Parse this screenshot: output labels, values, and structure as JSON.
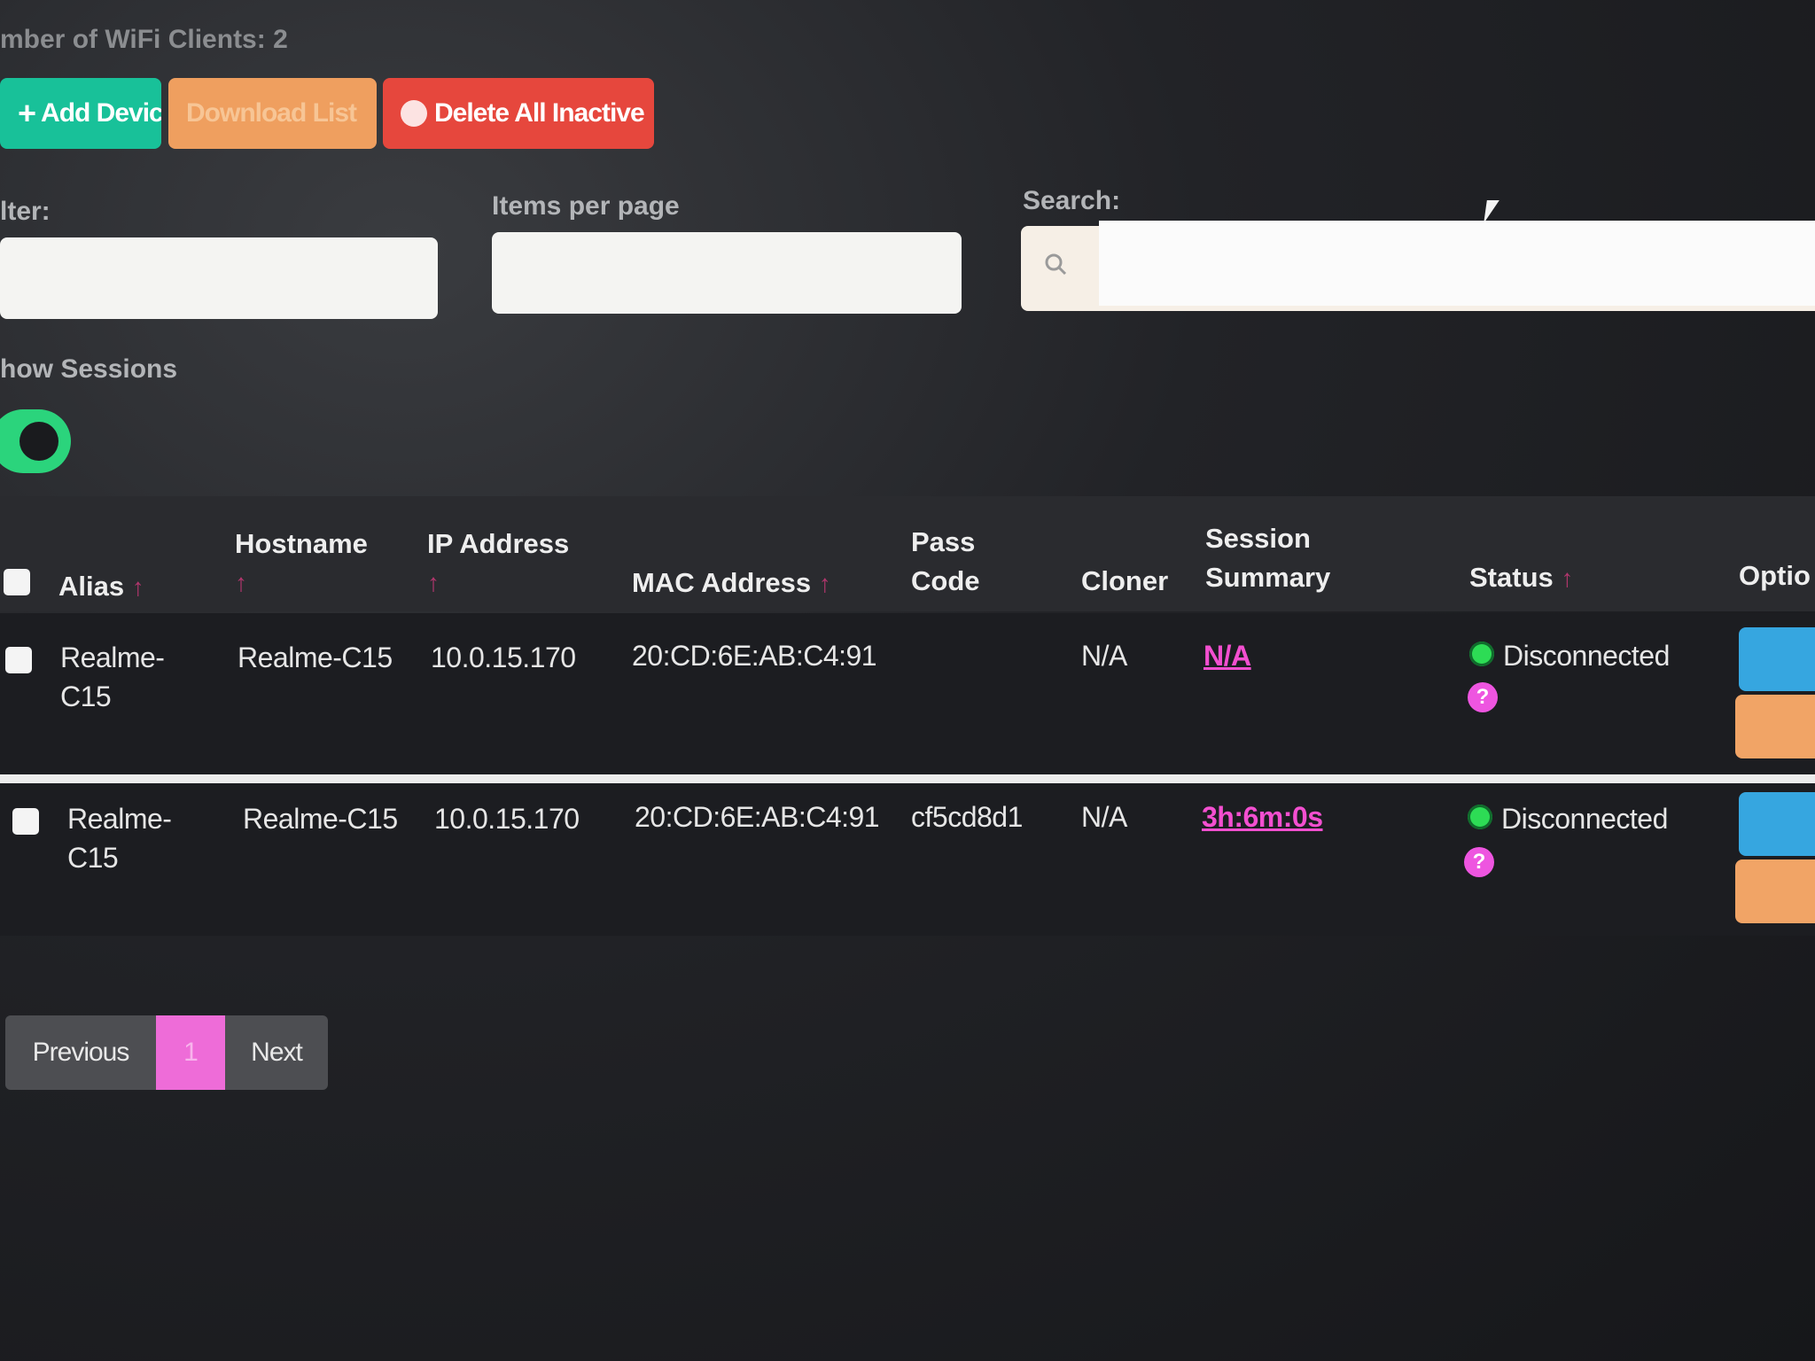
{
  "header": {
    "clients_text": "mber of WiFi Clients: 2"
  },
  "toolbar": {
    "add_label": "Add Device",
    "export_label": "Download List",
    "delete_label": "Delete All Inactive"
  },
  "filters": {
    "filter_label": "lter:",
    "items_label": "Items per page",
    "search_label": "Search:",
    "sessions_label": "how Sessions",
    "sessions_on": true
  },
  "table": {
    "headers": {
      "alias": "Alias",
      "hostname": "Hostname",
      "ip": "IP Address",
      "mac": "MAC Address",
      "pass1": "Pass",
      "pass2": "Code",
      "cloner": "Cloner",
      "session1": "Session",
      "session2": "Summary",
      "status": "Status",
      "options": "Optio"
    },
    "sort_arrow": "↑",
    "rows": [
      {
        "alias1": "Realme-",
        "alias2": "C15",
        "hostname": "Realme-C15",
        "ip": "10.0.15.170",
        "mac": "20:CD:6E:AB:C4:91",
        "pass_code": "",
        "cloner": "N/A",
        "session": "N/A",
        "status": "Disconnected",
        "help": "?"
      },
      {
        "alias1": "Realme-",
        "alias2": "C15",
        "hostname": "Realme-C15",
        "ip": "10.0.15.170",
        "mac": "20:CD:6E:AB:C4:91",
        "pass_code": "cf5cd8d1",
        "cloner": "N/A",
        "session": "3h:6m:0s",
        "status": "Disconnected",
        "help": "?"
      }
    ]
  },
  "pagination": {
    "previous": "Previous",
    "current": "1",
    "next": "Next"
  },
  "colors": {
    "add": "#18c199",
    "export": "#ef9f5f",
    "delete": "#e6473d",
    "accent": "#f34fd0",
    "status_dot": "#2ddc55"
  }
}
